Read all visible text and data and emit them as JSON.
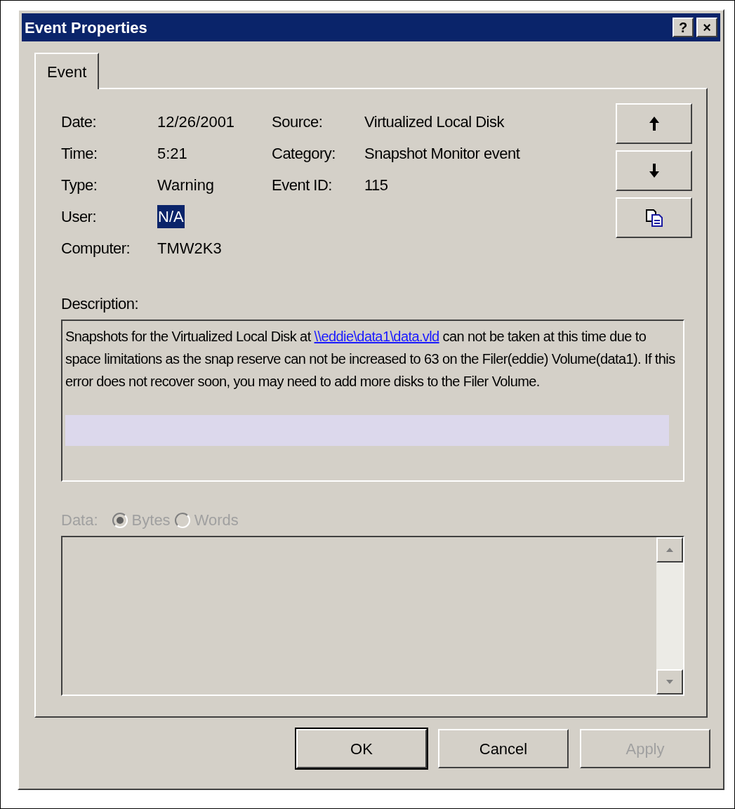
{
  "window": {
    "title": "Event Properties",
    "title_buttons": [
      "?",
      "×"
    ]
  },
  "tabs": [
    {
      "label": "Event",
      "selected": true
    }
  ],
  "fields": [
    {
      "label": "Date:",
      "value": "12/26/2001",
      "selected": false
    },
    {
      "label": "Time:",
      "value": "5:21",
      "selected": false
    },
    {
      "label": "Type:",
      "value": "Warning",
      "selected": false
    },
    {
      "label": "User:",
      "value": "N/A",
      "selected": true
    },
    {
      "label": "Computer:",
      "value": "TMW2K3",
      "selected": false
    }
  ],
  "fields_right": [
    {
      "label": "Source:",
      "value": "Virtualized Local Disk"
    },
    {
      "label": "Category:",
      "value": "Snapshot Monitor event"
    },
    {
      "label": "Event ID:",
      "value": "115"
    }
  ],
  "nav_buttons": [
    {
      "kind": "up"
    },
    {
      "kind": "down"
    },
    {
      "kind": "copy"
    }
  ],
  "description": {
    "label": "Description:",
    "text_before": "Snapshots for the Virtualized Local Disk at ",
    "link": "\\\\eddie\\data1\\data.vld",
    "text_after": " can not be taken at this time due to space limitations as the snap reserve can not be increased to 63 on the Filer(eddie) Volume(data1). If this error does not recover soon, you may need to add more disks to the Filer Volume."
  },
  "data": {
    "label": "Data:",
    "disabled": true,
    "options": [
      {
        "label": "Bytes",
        "selected": true
      },
      {
        "label": "Words",
        "selected": false
      }
    ]
  },
  "buttons": [
    {
      "label": "OK",
      "disabled": false,
      "default": true
    },
    {
      "label": "Cancel",
      "disabled": false,
      "default": false
    },
    {
      "label": "Apply",
      "disabled": true,
      "default": false
    }
  ]
}
